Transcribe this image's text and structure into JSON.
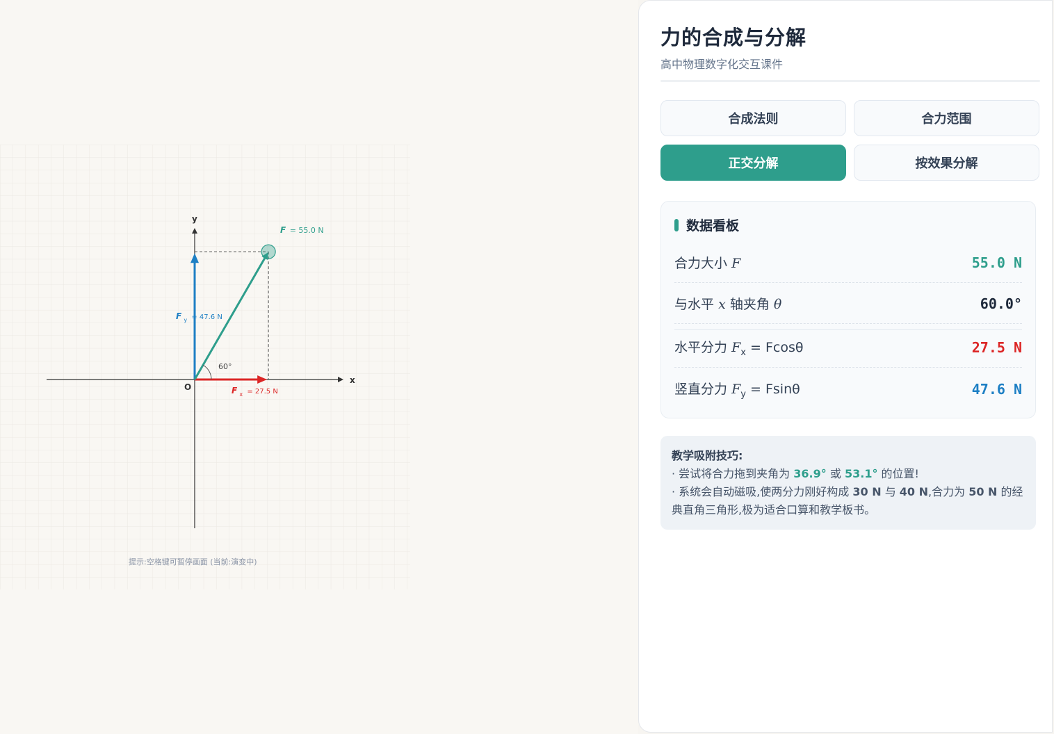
{
  "panel": {
    "title": "力的合成与分解",
    "subtitle": "高中物理数字化交互课件"
  },
  "tabs": [
    {
      "label": "合成法则",
      "active": false
    },
    {
      "label": "合力范围",
      "active": false
    },
    {
      "label": "正交分解",
      "active": true
    },
    {
      "label": "按效果分解",
      "active": false
    }
  ],
  "dashboard": {
    "title": "数据看板",
    "resultant_label": "合力大小",
    "resultant_sym": "F",
    "resultant_value": "55.0 N",
    "angle_label_a": "与水平",
    "angle_label_x": "x",
    "angle_label_b": "轴夹角",
    "angle_sym": "θ",
    "angle_value": "60.0°",
    "fx_label": "水平分力",
    "fx_formula": "= Fcosθ",
    "fx_value": "27.5 N",
    "fy_label": "竖直分力",
    "fy_formula": "= Fsinθ",
    "fy_value": "47.6 N"
  },
  "tips": {
    "title": "教学吸附技巧:",
    "l1a": "· 尝试将合力拖到夹角为",
    "v1": "36.9°",
    "l1b": "或",
    "v2": "53.1°",
    "l1c": "的位置!",
    "l2a": "· 系统会自动磁吸,使两分力刚好构成",
    "v3": "30 N",
    "l2b": "与",
    "v4": "40 N",
    "l2c": ",合力为",
    "v5": "50 N",
    "l2d": "的经典直角三角形,极为适合口算和教学板书。"
  },
  "diagram": {
    "F_magnitude": 55.0,
    "theta_deg": 60,
    "Fx": 27.5,
    "Fy": 47.6,
    "axis_x": "x",
    "axis_y": "y",
    "origin": "O",
    "F_sym": "F",
    "F_text": "= 55.0 N",
    "Fx_sym": "F",
    "Fx_sub": "x",
    "Fx_text": "= 27.5 N",
    "Fy_sym": "F",
    "Fy_sub": "y",
    "Fy_text": "= 47.6 N",
    "angle_text": "60°",
    "hint": "提示:空格键可暂停画面 (当前:演变中)",
    "colors": {
      "F": "#2e9e8c",
      "Fx": "#dc2626",
      "Fy": "#1d7fc4",
      "axis": "#333333"
    }
  }
}
